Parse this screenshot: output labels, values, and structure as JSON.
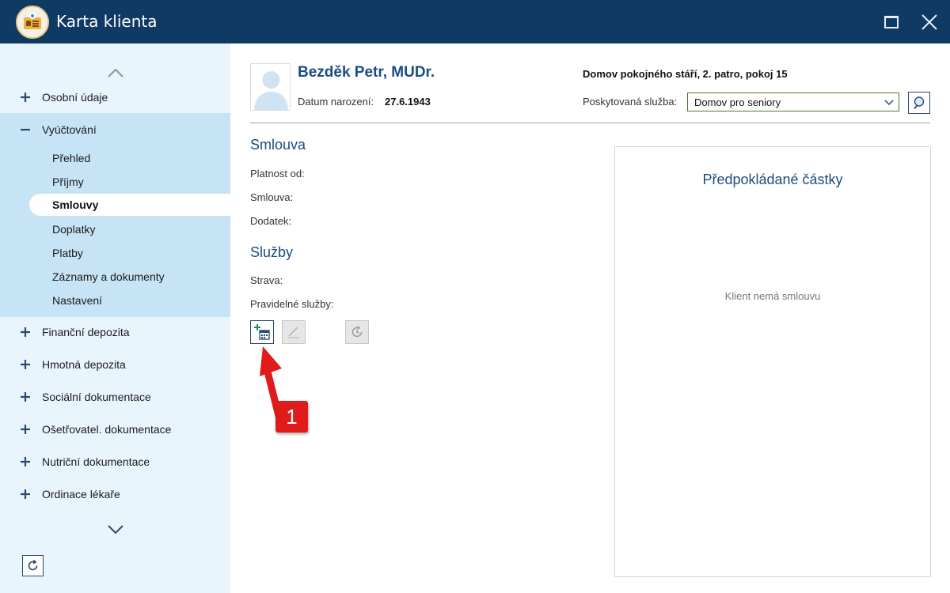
{
  "window": {
    "title": "Karta klienta"
  },
  "sidebar": {
    "items": [
      {
        "label": "Osobní údaje",
        "state": "collapsed"
      },
      {
        "label": "Vyúčtování",
        "state": "expanded"
      },
      {
        "label": "Finanční depozita",
        "state": "collapsed"
      },
      {
        "label": "Hmotná depozita",
        "state": "collapsed"
      },
      {
        "label": "Sociální dokumentace",
        "state": "collapsed"
      },
      {
        "label": "Ošetřovatel. dokumentace",
        "state": "collapsed"
      },
      {
        "label": "Nutriční dokumentace",
        "state": "collapsed"
      },
      {
        "label": "Ordinace lékaře",
        "state": "collapsed"
      }
    ],
    "subitems": [
      "Přehled",
      "Příjmy",
      "Smlouvy",
      "Doplatky",
      "Platby",
      "Záznamy a dokumenty",
      "Nastavení"
    ],
    "active_subitem": "Smlouvy"
  },
  "client": {
    "name": "Bezděk Petr, MUDr.",
    "dob_label": "Datum narození:",
    "dob_value": "27.6.1943",
    "location": "Domov pokojného stáří, 2. patro, pokoj 15",
    "service_label": "Poskytovaná služba:",
    "service_value": "Domov pro seniory"
  },
  "contract": {
    "title": "Smlouva",
    "valid_from_label": "Platnost od:",
    "contract_label": "Smlouva:",
    "addendum_label": "Dodatek:"
  },
  "services": {
    "title": "Služby",
    "meals_label": "Strava:",
    "regular_label": "Pravidelné služby:"
  },
  "amounts": {
    "title": "Předpokládané částky",
    "empty_message": "Klient nemá smlouvu"
  },
  "annotation": {
    "number": "1",
    "color": "#e01b1b"
  },
  "colors": {
    "titlebar": "#0f3a63",
    "sidebar_bg": "#e9f5fd",
    "sidebar_open_group": "#c6e4f6",
    "accent_text": "#1b4d80"
  }
}
